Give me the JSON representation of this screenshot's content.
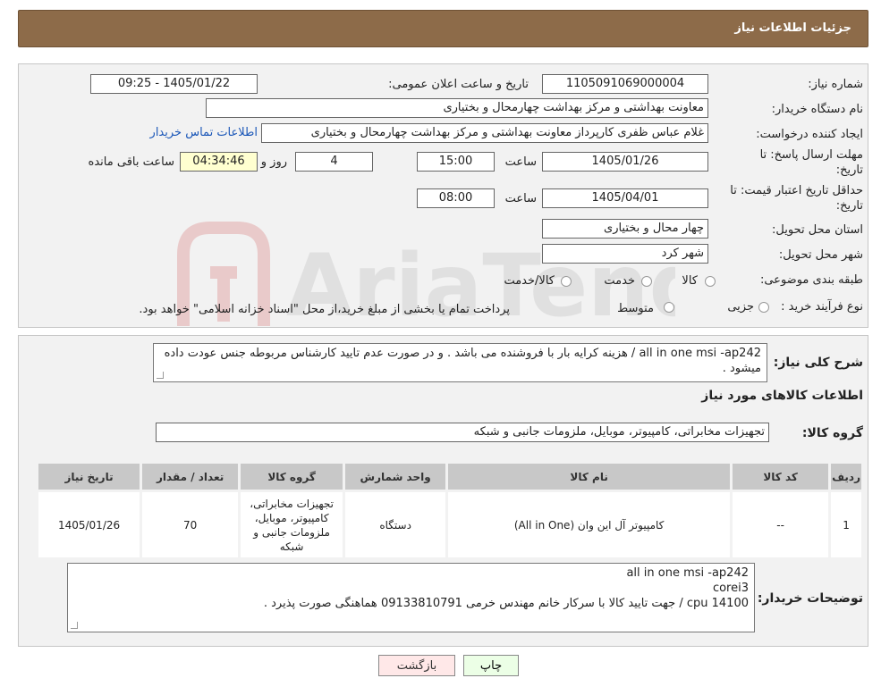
{
  "header": {
    "title": "جزئیات اطلاعات نیاز"
  },
  "form": {
    "need_number_label": "شماره نیاز:",
    "need_number": "1105091069000004",
    "announce_label": "تاریخ و ساعت اعلان عمومی:",
    "announce_value": "1405/01/22 - 09:25",
    "buyer_org_label": "نام دستگاه خریدار:",
    "buyer_org": "معاونت  بهداشتی  و مرکز بهداشت چهارمحال و بختیاری",
    "requester_label": "ایجاد کننده درخواست:",
    "requester": "غلام عباس ظفری کارپرداز معاونت  بهداشتی  و مرکز بهداشت چهارمحال و بختیاری",
    "contact_link": "اطلاعات تماس خریدار",
    "deadline_label_1": "مهلت ارسال پاسخ: تا",
    "deadline_label_2": "تاریخ:",
    "deadline_date": "1405/01/26",
    "time_label": "ساعت",
    "deadline_time": "15:00",
    "days_value": "4",
    "days_label": "روز و",
    "remaining_time": "04:34:46",
    "remaining_label": "ساعت باقی مانده",
    "validity_label_1": "حداقل تاریخ اعتبار قیمت: تا",
    "validity_label_2": "تاریخ:",
    "validity_date": "1405/04/01",
    "validity_time": "08:00",
    "province_label": "استان محل تحویل:",
    "province": "چهار محال و بختیاری",
    "city_label": "شهر محل تحویل:",
    "city": "شهر کرد",
    "category_label": "طبقه بندی موضوعی:",
    "category_options": [
      "کالا",
      "خدمت",
      "کالا/خدمت"
    ],
    "process_label": "نوع فرآیند خرید :",
    "process_options": [
      "جزیی",
      "متوسط"
    ],
    "process_note": "پرداخت تمام یا بخشی از مبلغ خرید،از محل \"اسناد خزانه اسلامی\" خواهد بود."
  },
  "summary": {
    "label": "شرح کلی نیاز:",
    "text": "all in one msi -ap242 / هزینه کرایه بار با فروشنده می باشد . و در صورت عدم تایید کارشناس مربوطه جنس عودت داده میشود .",
    "goods_info_title": "اطلاعات کالاهای مورد نیاز",
    "goods_group_label": "گروه کالا:",
    "goods_group": "تجهیزات مخابراتی، کامپیوتر، موبایل، ملزومات جانبی و شبکه"
  },
  "table": {
    "headers": [
      "ردیف",
      "کد کالا",
      "نام کالا",
      "واحد شمارش",
      "گروه کالا",
      "تعداد / مقدار",
      "تاریخ نیاز"
    ],
    "rows": [
      [
        "1",
        "--",
        "کامپیوتر آل این وان (All in One)",
        "دستگاه",
        "تجهیزات مخابراتی، کامپیوتر، موبایل، ملزومات جانبی و شبکه",
        "70",
        "1405/01/26"
      ]
    ]
  },
  "buyer_notes": {
    "label": "توضیحات خریدار:",
    "line1": "all in one msi -ap242",
    "line2": "corei3",
    "line3": "cpu 14100 / جهت تایید کالا با سرکار خانم مهندس خرمی 09133810791 هماهنگی صورت پذیرد ."
  },
  "buttons": {
    "print": "چاپ",
    "back": "بازگشت"
  },
  "watermark": {
    "text": "AriaTender.neT"
  },
  "colors": {
    "header_bg": "#8d6b49",
    "panel_bg": "#f2f2f2",
    "link": "#1b57b8",
    "back_btn_bg": "#ffe8e8",
    "print_btn_bg": "#ecffe6"
  }
}
